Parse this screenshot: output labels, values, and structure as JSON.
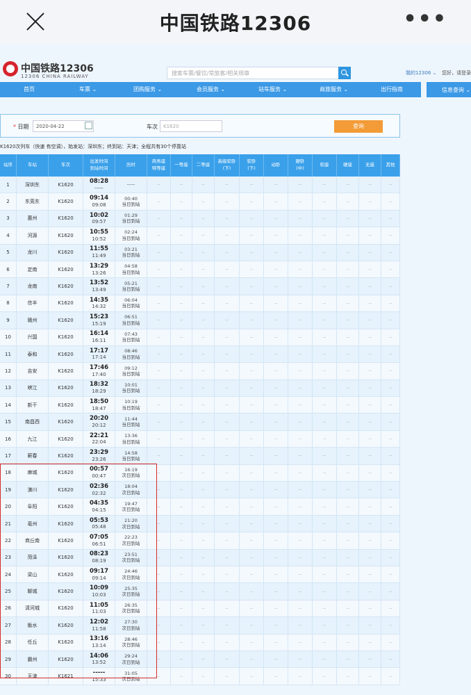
{
  "appbar": {
    "title": "中国铁路12306",
    "more": "•••"
  },
  "header": {
    "logo_title": "中国铁路12306",
    "logo_sub": "12306 CHINA RAILWAY",
    "search_placeholder": "搜索车票/餐饮/常旅客/相关规章",
    "my12306": "我的12306 ⌄",
    "greeting": "您好，请登录"
  },
  "nav": {
    "items": [
      "首页",
      "车票 ⌄",
      "团购服务 ⌄",
      "会员服务 ⌄",
      "站车服务 ⌄",
      "商旅服务 ⌄",
      "出行指南"
    ],
    "info": "信息查询 ⌄"
  },
  "query": {
    "date_label": "日期",
    "date_value": "2020-04-22",
    "train_label": "车次",
    "train_placeholder": "K1620",
    "button": "查询"
  },
  "summary": "K1620次列车（快速 有空调），始发站：深圳东；终到站：天津；全程共有30个停靠站",
  "table": {
    "headers": [
      "站序",
      "车站",
      "车次",
      "出发时间\n到站时间",
      "历时",
      "商务座\n特等座",
      "一等座",
      "二等座",
      "高级软卧\n(下)",
      "软卧\n(下)",
      "动卧",
      "硬卧\n(中)",
      "软座",
      "硬座",
      "无座",
      "其他"
    ],
    "seat_placeholder": "--",
    "rows": [
      {
        "no": "1",
        "station": "深圳东",
        "train": "K1620",
        "t1": "08:28",
        "t2": "-----",
        "d1": "-----",
        "d2": ""
      },
      {
        "no": "2",
        "station": "东莞东",
        "train": "K1620",
        "t1": "09:14",
        "t2": "09:08",
        "d1": "00:40",
        "d2": "当日到站"
      },
      {
        "no": "3",
        "station": "惠州",
        "train": "K1620",
        "t1": "10:02",
        "t2": "09:57",
        "d1": "01:29",
        "d2": "当日到站"
      },
      {
        "no": "4",
        "station": "河源",
        "train": "K1620",
        "t1": "10:55",
        "t2": "10:52",
        "d1": "02:24",
        "d2": "当日到站"
      },
      {
        "no": "5",
        "station": "龙川",
        "train": "K1620",
        "t1": "11:55",
        "t2": "11:49",
        "d1": "03:21",
        "d2": "当日到站"
      },
      {
        "no": "6",
        "station": "定南",
        "train": "K1620",
        "t1": "13:29",
        "t2": "13:26",
        "d1": "04:58",
        "d2": "当日到站"
      },
      {
        "no": "7",
        "station": "龙南",
        "train": "K1620",
        "t1": "13:52",
        "t2": "13:49",
        "d1": "05:21",
        "d2": "当日到站"
      },
      {
        "no": "8",
        "station": "信丰",
        "train": "K1620",
        "t1": "14:35",
        "t2": "14:32",
        "d1": "06:04",
        "d2": "当日到站"
      },
      {
        "no": "9",
        "station": "赣州",
        "train": "K1620",
        "t1": "15:23",
        "t2": "15:19",
        "d1": "06:51",
        "d2": "当日到站"
      },
      {
        "no": "10",
        "station": "兴国",
        "train": "K1620",
        "t1": "16:14",
        "t2": "16:11",
        "d1": "07:43",
        "d2": "当日到站"
      },
      {
        "no": "11",
        "station": "泰和",
        "train": "K1620",
        "t1": "17:17",
        "t2": "17:14",
        "d1": "08:46",
        "d2": "当日到站"
      },
      {
        "no": "12",
        "station": "吉安",
        "train": "K1620",
        "t1": "17:46",
        "t2": "17:40",
        "d1": "09:12",
        "d2": "当日到站"
      },
      {
        "no": "13",
        "station": "峡江",
        "train": "K1620",
        "t1": "18:32",
        "t2": "18:29",
        "d1": "10:01",
        "d2": "当日到站"
      },
      {
        "no": "14",
        "station": "新干",
        "train": "K1620",
        "t1": "18:50",
        "t2": "18:47",
        "d1": "10:19",
        "d2": "当日到站"
      },
      {
        "no": "15",
        "station": "南昌西",
        "train": "K1620",
        "t1": "20:20",
        "t2": "20:12",
        "d1": "11:44",
        "d2": "当日到站"
      },
      {
        "no": "16",
        "station": "九江",
        "train": "K1620",
        "t1": "22:21",
        "t2": "22:04",
        "d1": "13:36",
        "d2": "当日到站"
      },
      {
        "no": "17",
        "station": "蕲春",
        "train": "K1620",
        "t1": "23:29",
        "t2": "23:26",
        "d1": "14:58",
        "d2": "当日到站"
      },
      {
        "no": "18",
        "station": "麻城",
        "train": "K1620",
        "t1": "00:57",
        "t2": "00:47",
        "d1": "16:19",
        "d2": "次日到站"
      },
      {
        "no": "19",
        "station": "潢川",
        "train": "K1620",
        "t1": "02:36",
        "t2": "02:32",
        "d1": "18:04",
        "d2": "次日到站"
      },
      {
        "no": "20",
        "station": "阜阳",
        "train": "K1620",
        "t1": "04:35",
        "t2": "04:15",
        "d1": "19:47",
        "d2": "次日到站"
      },
      {
        "no": "21",
        "station": "亳州",
        "train": "K1620",
        "t1": "05:53",
        "t2": "05:48",
        "d1": "21:20",
        "d2": "次日到站"
      },
      {
        "no": "22",
        "station": "商丘南",
        "train": "K1620",
        "t1": "07:05",
        "t2": "06:51",
        "d1": "22:23",
        "d2": "次日到站"
      },
      {
        "no": "23",
        "station": "菏泽",
        "train": "K1620",
        "t1": "08:23",
        "t2": "08:19",
        "d1": "23:51",
        "d2": "次日到站"
      },
      {
        "no": "24",
        "station": "梁山",
        "train": "K1620",
        "t1": "09:17",
        "t2": "09:14",
        "d1": "24:46",
        "d2": "次日到站"
      },
      {
        "no": "25",
        "station": "聊城",
        "train": "K1620",
        "t1": "10:09",
        "t2": "10:03",
        "d1": "25:35",
        "d2": "次日到站"
      },
      {
        "no": "26",
        "station": "清河城",
        "train": "K1620",
        "t1": "11:05",
        "t2": "11:03",
        "d1": "26:35",
        "d2": "次日到站"
      },
      {
        "no": "27",
        "station": "衡水",
        "train": "K1620",
        "t1": "12:02",
        "t2": "11:58",
        "d1": "27:30",
        "d2": "次日到站"
      },
      {
        "no": "28",
        "station": "任丘",
        "train": "K1620",
        "t1": "13:16",
        "t2": "13:14",
        "d1": "28:46",
        "d2": "次日到站"
      },
      {
        "no": "29",
        "station": "霸州",
        "train": "K1620",
        "t1": "14:06",
        "t2": "13:52",
        "d1": "29:24",
        "d2": "次日到站"
      },
      {
        "no": "30",
        "station": "天津",
        "train": "K1621",
        "t1": "-----",
        "t2": "15:33",
        "d1": "31:05",
        "d2": "次日到站"
      }
    ]
  },
  "colors": {
    "accent": "#3b99e6",
    "query_button": "#f39b37",
    "highlight": "#d62b2b",
    "logo": "#d6242c"
  }
}
